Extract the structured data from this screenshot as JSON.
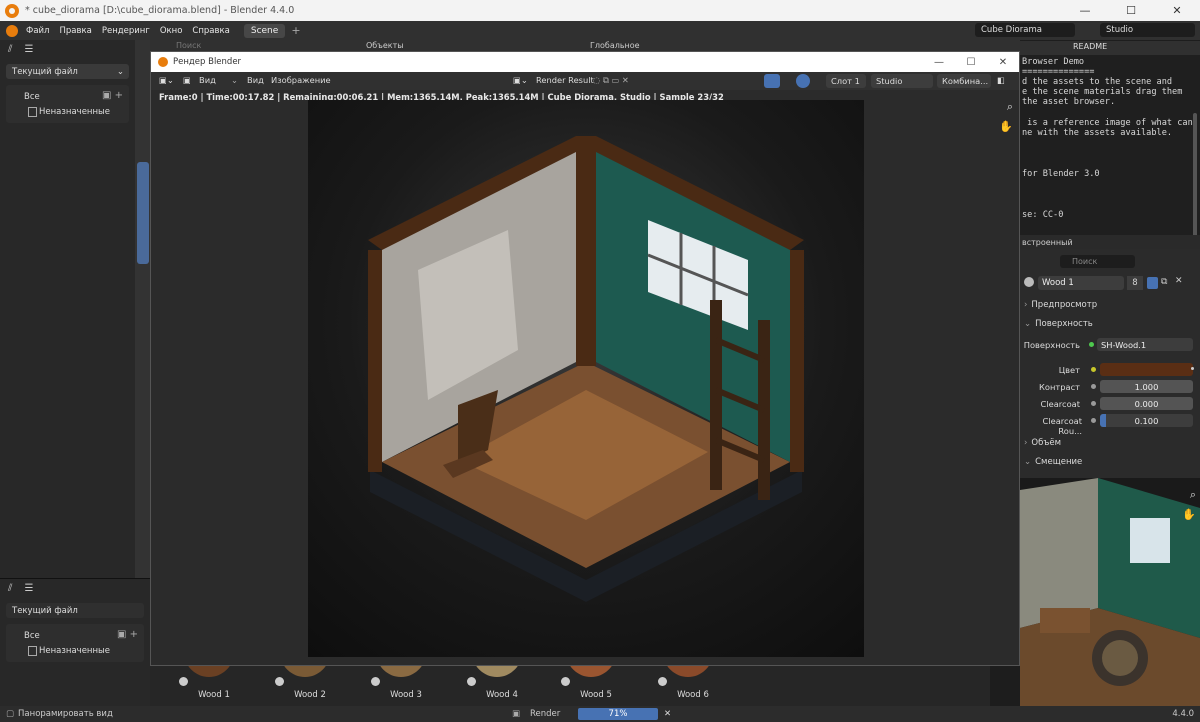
{
  "window": {
    "title": "* cube_diorama [D:\\cube_diorama.blend] - Blender 4.4.0",
    "min": "—",
    "max": "☐",
    "close": "✕"
  },
  "menu": [
    "Файл",
    "Правка",
    "Рендеринг",
    "Окно",
    "Справка"
  ],
  "scene_tab": "Scene",
  "scene_field": "Cube Diorama",
  "view_layer_field": "Studio",
  "outliner_search_placeholder": "Поиск",
  "objects_dropdown": "Объекты",
  "global_dropdown": "Глобальное",
  "readme_tab": "README",
  "left_panel": {
    "library": "Текущий файл",
    "all": "Все",
    "unassigned": "Неназначенные"
  },
  "left_panel2": {
    "library": "Текущий файл",
    "all": "Все",
    "unassigned": "Неназначенные"
  },
  "text_editor": {
    "lines": [
      "Browser Demo",
      "==============",
      "d the assets to the scene and",
      "e the scene materials drag them",
      "the asset browser.",
      "",
      " is a reference image of what can",
      "ne with the assets available.",
      "",
      "",
      "for Blender 3.0",
      "",
      "",
      "se: CC-0"
    ]
  },
  "props": {
    "section_label": "встроенный",
    "search_placeholder": "Поиск",
    "material_name": "Wood 1",
    "material_users": "8",
    "preview": "Предпросмотр",
    "surface_section": "Поверхность",
    "surface_label": "Поверхность",
    "surface_value": "SH-Wood.1",
    "color_label": "Цвет",
    "color_value": "#5a2e14",
    "contrast_label": "Контраст",
    "contrast_value": "1.000",
    "clearcoat_label": "Clearcoat",
    "clearcoat_value": "0.000",
    "clearcoat_rough_label": "Clearcoat Rou...",
    "clearcoat_rough_value": "0.100",
    "volume_section": "Объём",
    "displacement_section": "Смещение"
  },
  "assets": [
    {
      "name": "Wood 1",
      "color": "#6a4023"
    },
    {
      "name": "Wood 2",
      "color": "#7a5a35"
    },
    {
      "name": "Wood 3",
      "color": "#8a6a42"
    },
    {
      "name": "Wood 4",
      "color": "#a08a60"
    },
    {
      "name": "Wood 5",
      "color": "#9a5530"
    },
    {
      "name": "Wood 6",
      "color": "#8a4a2a"
    }
  ],
  "status": {
    "left": "Панорамировать вид",
    "render_label": "Render",
    "progress_label": "71%",
    "progress_value": 0.71,
    "version": "4.4.0"
  },
  "render_window": {
    "title": "Рендер Blender",
    "menu_view1": "Вид",
    "menu_view2": "Вид",
    "menu_image": "Изображение",
    "image_name": "Render Result",
    "slot": "Слот 1",
    "layer": "Studio",
    "pass": "Комбина...",
    "info": "Frame:0 | Time:00:17.82 | Remaining:00:06.21 | Mem:1365.14M, Peak:1365.14M | Cube Diorama, Studio | Sample 23/32"
  }
}
